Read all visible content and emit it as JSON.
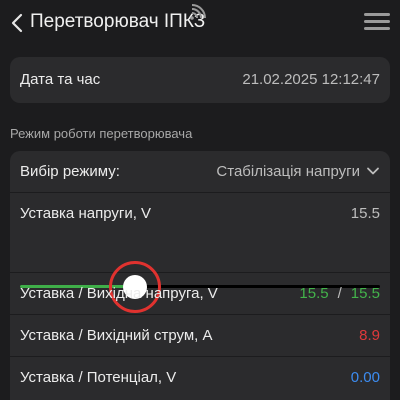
{
  "header": {
    "title": "Перетворювач ІПКЗ",
    "icons": {
      "back": "chevron-left-icon",
      "signal": "wifi-icon",
      "menu": "hamburger-menu-icon"
    }
  },
  "datetime": {
    "label": "Дата та час",
    "value": "21.02.2025 12:12:47"
  },
  "section": {
    "caption": "Режим роботи перетворювача"
  },
  "mode_select": {
    "label": "Вибір режиму:",
    "value": "Стабілізація напруги"
  },
  "voltage_setpoint": {
    "label": "Уставка напруги, V",
    "value": "15.5",
    "slider_fraction": 0.32
  },
  "output_voltage": {
    "label": "Уставка / Вихідна напруга, V",
    "setpoint": "15.5",
    "separator": "/",
    "actual": "15.5"
  },
  "output_current": {
    "label": "Уставка / Вихідний струм, A",
    "value": "8.9"
  },
  "potential": {
    "label": "Уставка / Потенціал, V",
    "value": "0.00"
  },
  "colors": {
    "background": "#1c1c1e",
    "card": "#2b2b2d",
    "accent_green": "#43b34b",
    "accent_red": "#e0393b",
    "accent_blue": "#3c8cf0",
    "focus_ring": "#e0322f"
  }
}
